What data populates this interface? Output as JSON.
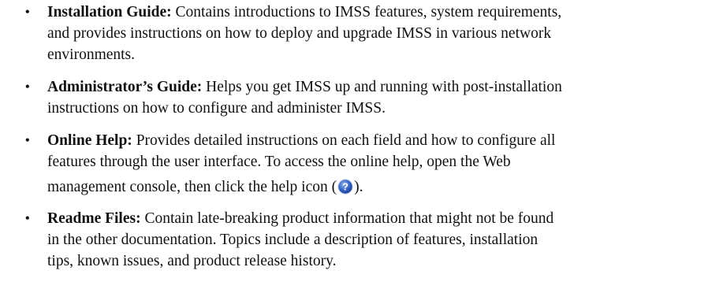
{
  "guides": [
    {
      "term": "Installation Guide:",
      "lines": [
        "Contains introductions to IMSS features, system requirements,",
        "and provides instructions on how to deploy and upgrade IMSS in various network",
        "environments."
      ]
    },
    {
      "term": "Administrator’s Guide:",
      "lines": [
        "Helps you get IMSS up and running with post-installation",
        "instructions on how to configure and administer IMSS."
      ]
    },
    {
      "term": "Online Help:",
      "lines": [
        "Provides detailed instructions on each field and how to configure all",
        "features through the user interface. To access the online help, open the Web"
      ],
      "last_line_before_icon": "management console, then click the help icon (",
      "last_line_after_icon": ").",
      "icon": "help-icon"
    },
    {
      "term": "Readme Files:",
      "lines": [
        "Contain late-breaking product information that might not be found",
        "in the other documentation. Topics include a description of features, installation",
        "tips, known issues, and product release history."
      ]
    }
  ],
  "bullet_glyph": "•",
  "colors": {
    "text": "#111111",
    "icon_blue": "#2f5fbf"
  }
}
